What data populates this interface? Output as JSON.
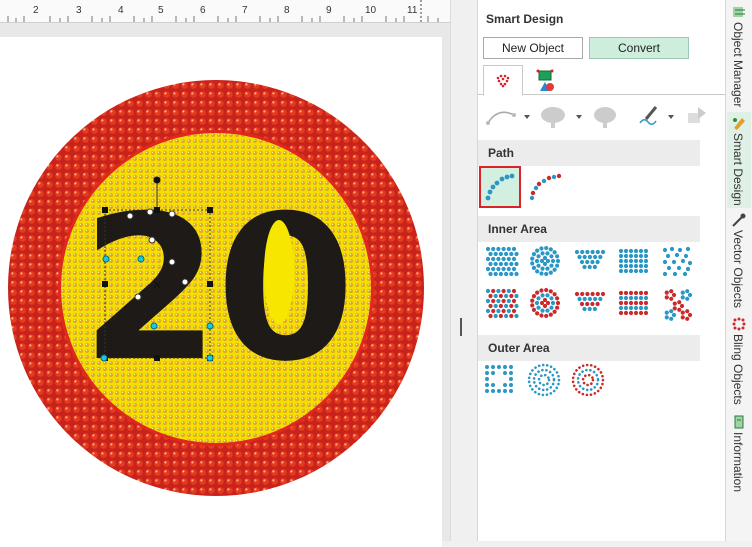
{
  "ruler": {
    "ticks": [
      "2",
      "3",
      "4",
      "5",
      "6",
      "7",
      "8",
      "9",
      "10",
      "11"
    ]
  },
  "artwork": {
    "number_text": "20"
  },
  "panel": {
    "title": "Smart Design",
    "new_object_label": "New Object",
    "convert_label": "Convert",
    "sections": {
      "path": "Path",
      "inner_area": "Inner Area",
      "outer_area": "Outer Area"
    }
  },
  "side_tabs": [
    "Object Manager",
    "Smart Design",
    "Vector Objects",
    "Bling Objects",
    "Information"
  ],
  "colors": {
    "accent_green": "#cdeedd",
    "selection_red": "#d9232a",
    "rhinestone_blue": "#2a97c5",
    "rhinestone_red": "#cc2a2a"
  }
}
